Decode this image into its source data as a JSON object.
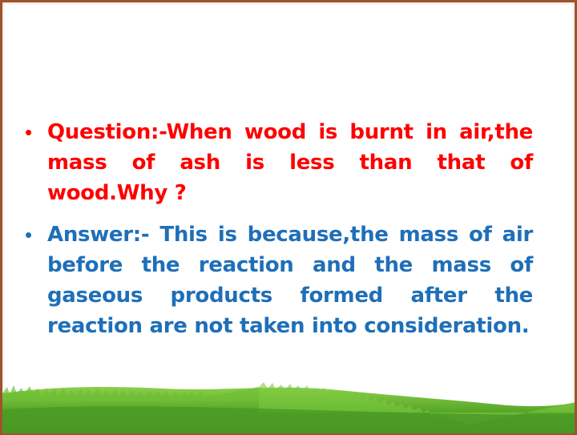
{
  "slide": {
    "question": "Question:-When wood is burnt in air,the mass of ash is less than that of wood.Why ?",
    "answer": "Answer:- This  is because,the mass of air before the reaction and the mass of gaseous products formed after the reaction are not taken into consideration.",
    "bullet_glyph": "•"
  },
  "colors": {
    "question": "#ff0000",
    "answer": "#1f6fb8",
    "frame": "#a0522d",
    "grass_dark": "#3f8f1f",
    "grass_light": "#8bd04a"
  }
}
